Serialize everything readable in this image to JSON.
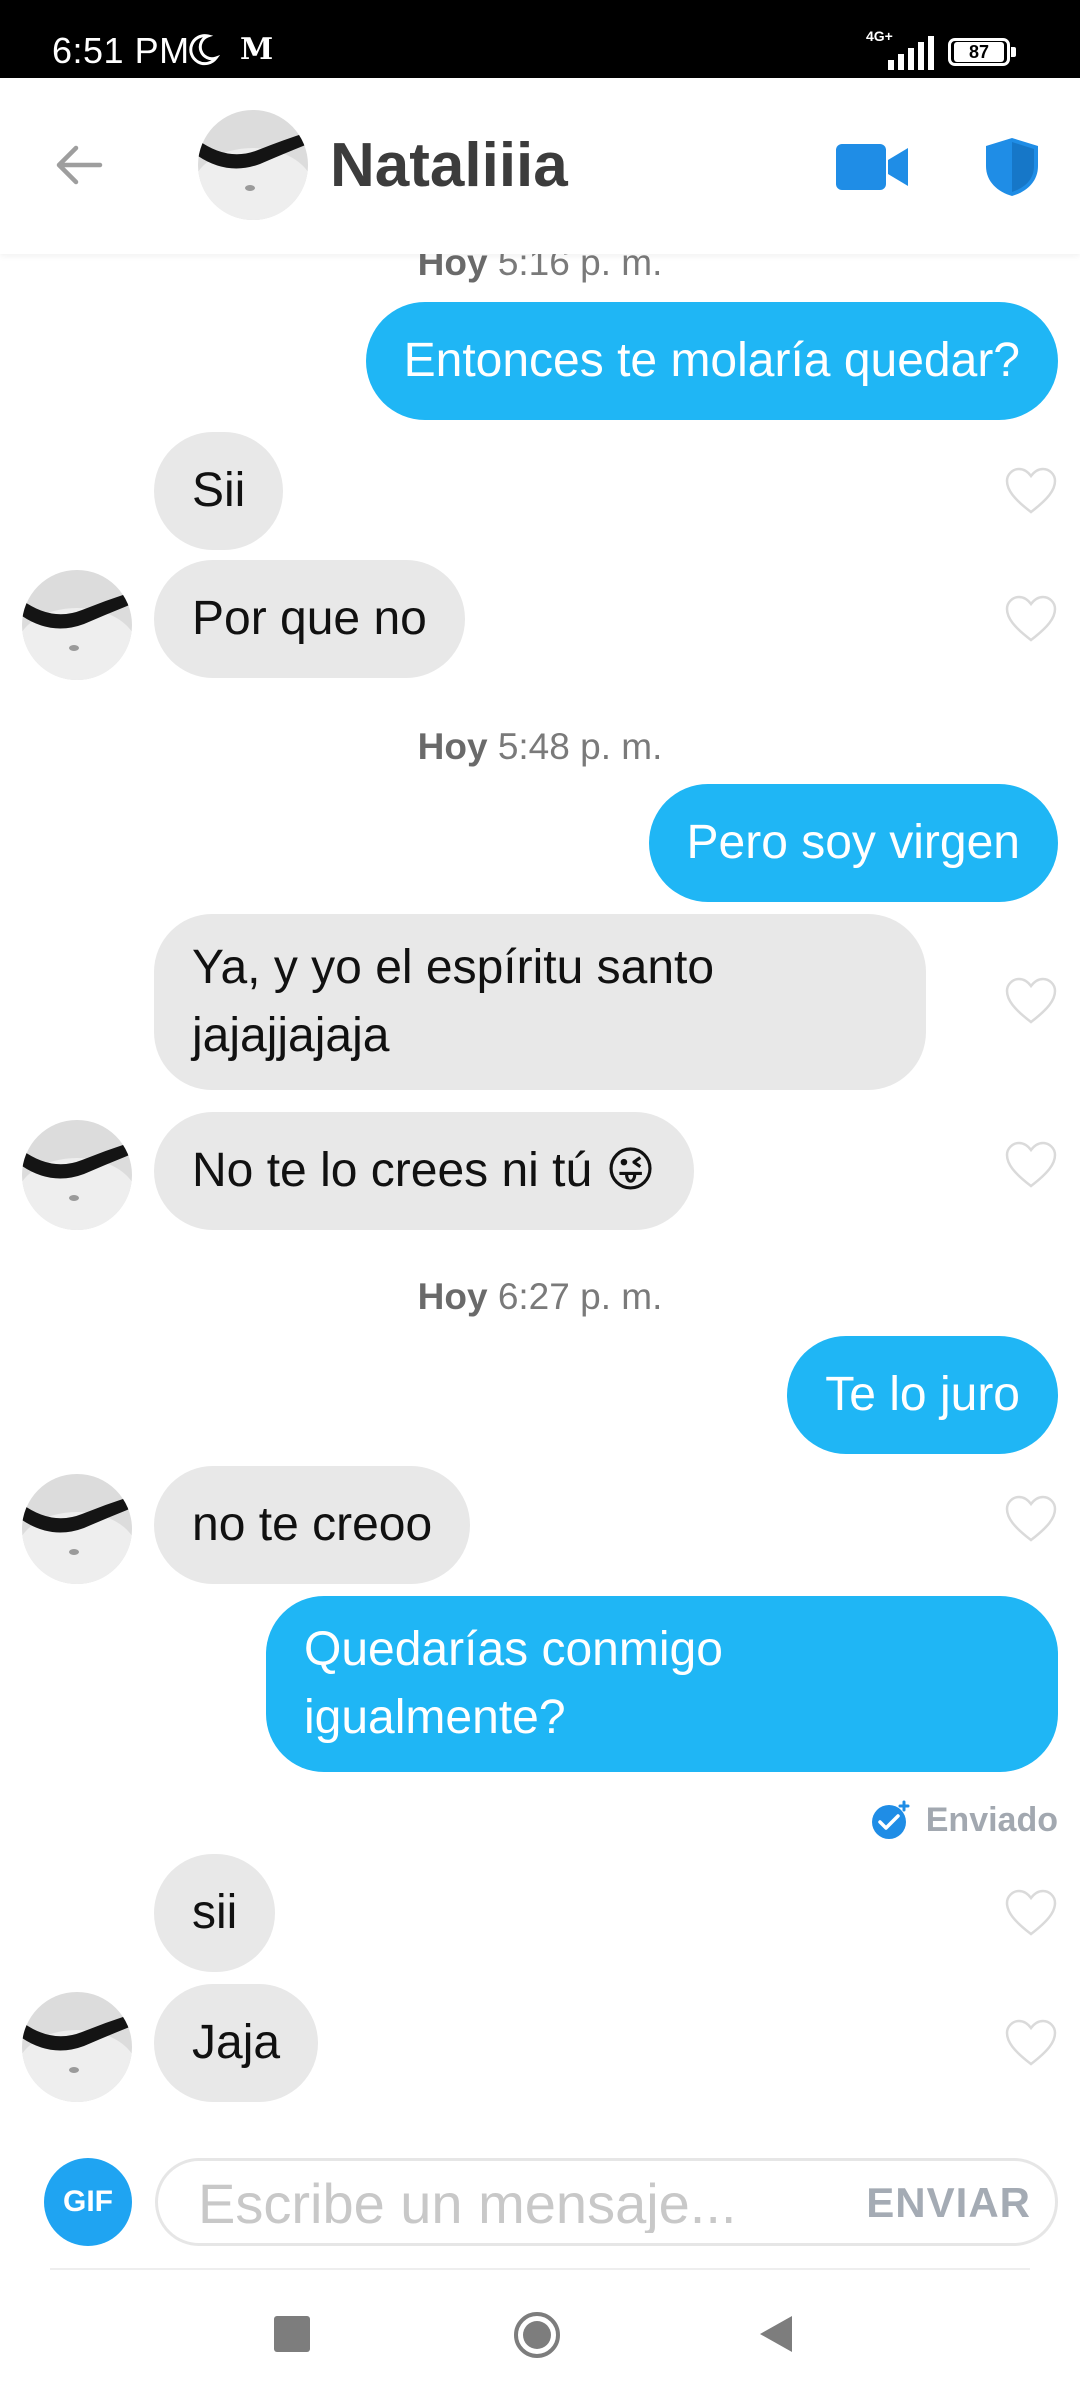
{
  "status_bar": {
    "time": "6:51 PM",
    "app_letter": "M",
    "network": "4G+",
    "battery": "87"
  },
  "header": {
    "contact_name": "Nataliiia"
  },
  "timestamps": [
    {
      "day": "Hoy",
      "time": "5:16 p. m."
    },
    {
      "day": "Hoy",
      "time": "5:48 p. m."
    },
    {
      "day": "Hoy",
      "time": "6:27 p. m."
    }
  ],
  "messages": [
    {
      "from": "me",
      "text": "Entonces te molaría quedar?"
    },
    {
      "from": "them",
      "text": "Sii"
    },
    {
      "from": "them",
      "text": "Por que no"
    },
    {
      "from": "me",
      "text": "Pero soy virgen"
    },
    {
      "from": "them",
      "text_line1": "Ya, y yo el espíritu santo",
      "text_line2": "jajajjajaja"
    },
    {
      "from": "them",
      "text": "No te lo crees ni tú 😜"
    },
    {
      "from": "me",
      "text": "Te lo juro"
    },
    {
      "from": "them",
      "text": "no te creoo"
    },
    {
      "from": "me",
      "text_line1": "Quedarías conmigo",
      "text_line2": "igualmente?"
    },
    {
      "from": "them",
      "text": "sii"
    },
    {
      "from": "them",
      "text": "Jaja"
    }
  ],
  "delivery_status": "Enviado",
  "composer": {
    "gif_label": "GIF",
    "placeholder": "Escribe un mensaje...",
    "send_label": "ENVIAR"
  },
  "colors": {
    "outgoing": "#1fb6f5",
    "incoming": "#e8e8e8",
    "accent": "#1fa4f2"
  },
  "icons": [
    "back-arrow-icon",
    "video-call-icon",
    "shield-icon",
    "heart-icon",
    "delivered-check-icon",
    "nav-recents-icon",
    "nav-home-icon",
    "nav-back-icon"
  ]
}
